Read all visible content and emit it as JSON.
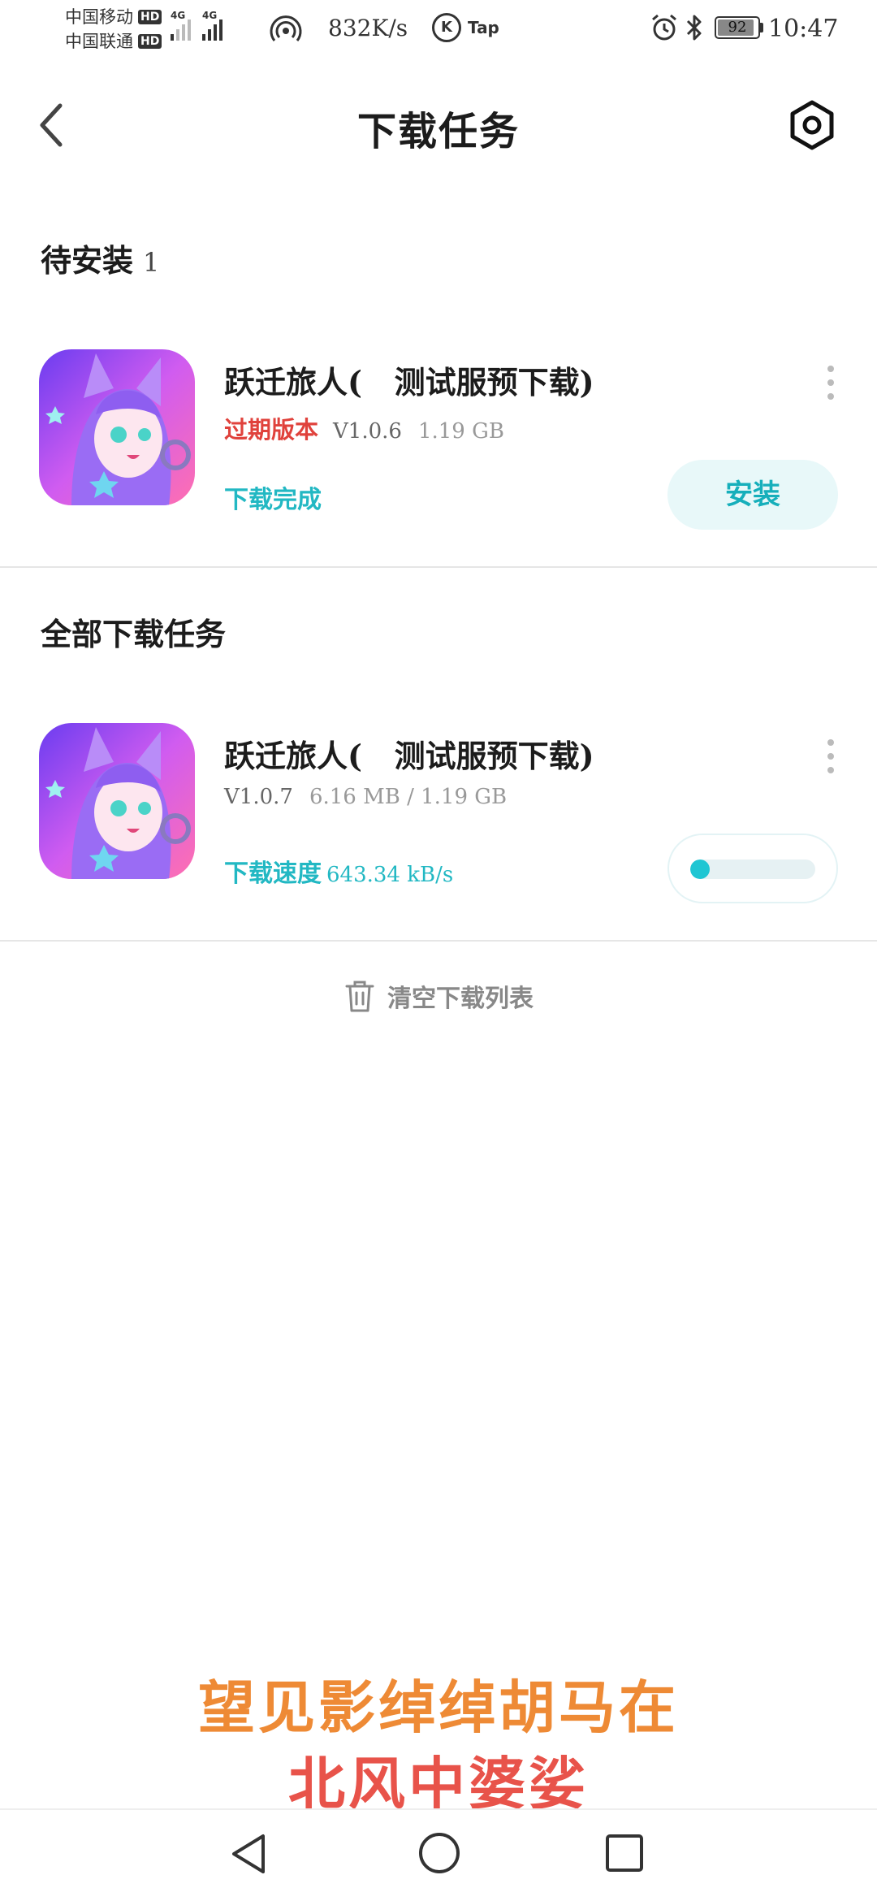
{
  "status_bar": {
    "carrier_1": "中国移动",
    "carrier_2": "中国联通",
    "hd_label": "HD",
    "network_1": "4G",
    "network_2": "4G",
    "net_speed": "832K/s",
    "k_icon_letter": "K",
    "tap_label": "Tap",
    "battery": "92",
    "battery_level": 0.92,
    "time": "10:47"
  },
  "header": {
    "title": "下载任务"
  },
  "pending_section": {
    "heading": "待安装",
    "count": "1"
  },
  "pending_task": {
    "name": "跃迁旅人(   测试服预下载)",
    "expired_label": "过期版本",
    "version": "V1.0.6",
    "size": "1.19 GB",
    "status": "下载完成",
    "install_label": "安装"
  },
  "all_section": {
    "heading": "全部下载任务"
  },
  "download_task": {
    "name": "跃迁旅人(   测试服预下载)",
    "version": "V1.0.7",
    "progress_text": "6.16 MB / 1.19 GB",
    "speed_label": "下载速度",
    "speed_value": "643.34 kB/s",
    "progress_fraction": 0.005
  },
  "clear_list_label": "清空下载列表",
  "caption": {
    "line_1": "望见影绰绰胡马在",
    "line_2": "北风中婆娑"
  },
  "colors": {
    "accent": "#1fc6d3",
    "expired": "#e0423c",
    "install_bg": "#e8f8f9",
    "caption_orange": "#ee8a35",
    "caption_red": "#e8534a"
  },
  "icons": [
    "back-icon",
    "settings-icon",
    "more-icon",
    "trash-icon",
    "nav-back-icon",
    "nav-home-icon",
    "nav-recents-icon",
    "alarm-icon",
    "bluetooth-icon",
    "hotspot-icon"
  ]
}
